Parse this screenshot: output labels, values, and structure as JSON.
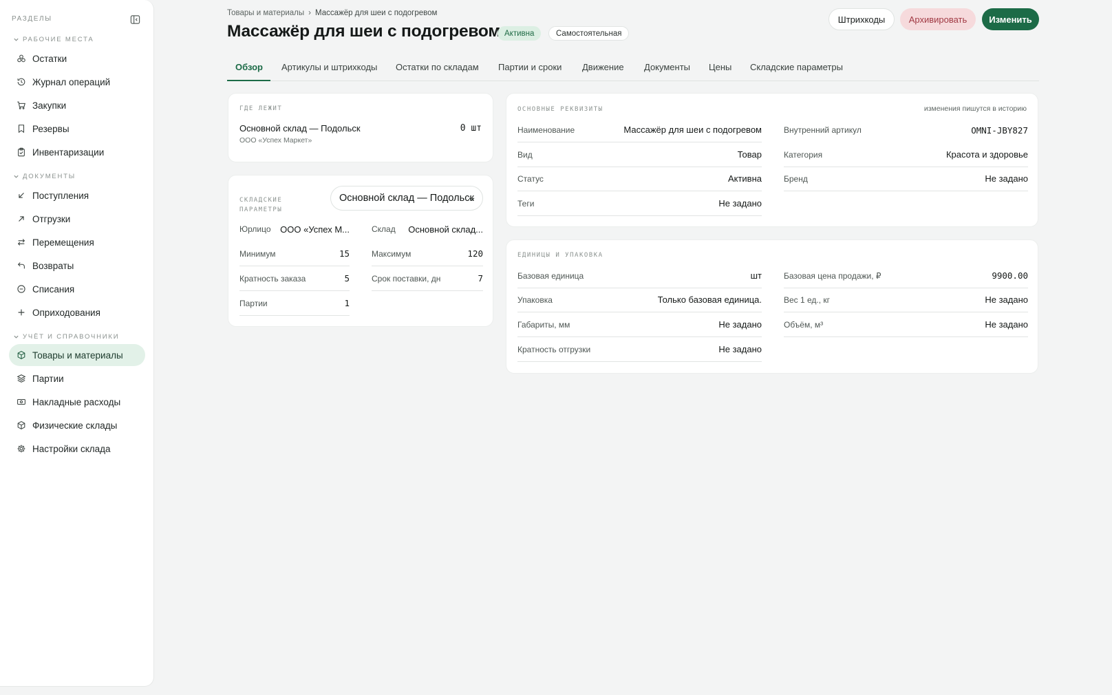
{
  "sidebar": {
    "header": "РАЗДЕЛЫ",
    "groups": [
      {
        "label": "РАБОЧИЕ МЕСТА",
        "items": [
          {
            "label": "Остатки",
            "icon": "boxes-icon"
          },
          {
            "label": "Журнал операций",
            "icon": "history-icon"
          },
          {
            "label": "Закупки",
            "icon": "cart-icon"
          },
          {
            "label": "Резервы",
            "icon": "bookmark-icon"
          },
          {
            "label": "Инвентаризации",
            "icon": "clipboard-icon"
          }
        ]
      },
      {
        "label": "ДОКУМЕНТЫ",
        "items": [
          {
            "label": "Поступления",
            "icon": "arrow-down-left-icon"
          },
          {
            "label": "Отгрузки",
            "icon": "arrow-up-right-icon"
          },
          {
            "label": "Перемещения",
            "icon": "swap-icon"
          },
          {
            "label": "Возвраты",
            "icon": "undo-icon"
          },
          {
            "label": "Списания",
            "icon": "minus-circle-icon"
          },
          {
            "label": "Оприходования",
            "icon": "plus-icon"
          }
        ]
      },
      {
        "label": "УЧЁТ И СПРАВОЧНИКИ",
        "items": [
          {
            "label": "Товары и материалы",
            "icon": "package-icon",
            "active": true
          },
          {
            "label": "Партии",
            "icon": "layers-icon"
          },
          {
            "label": "Накладные расходы",
            "icon": "banknote-icon"
          },
          {
            "label": "Физические склады",
            "icon": "package-icon"
          },
          {
            "label": "Настройки склада",
            "icon": "gear-icon"
          }
        ]
      }
    ]
  },
  "breadcrumb": {
    "parent": "Товары и материалы",
    "separator": "›",
    "current": "Массажёр для шеи с подогревом"
  },
  "header": {
    "title": "Массажёр для шеи с подогревом",
    "status_badge": "Активна",
    "type_badge": "Самостоятельная",
    "buttons": {
      "barcodes": "Штрихкоды",
      "archive": "Архивировать",
      "edit": "Изменить"
    }
  },
  "tabs": [
    "Обзор",
    "Артикулы и штрихкоды",
    "Остатки по складам",
    "Партии и сроки",
    "Движение",
    "Документы",
    "Цены",
    "Складские параметры"
  ],
  "where": {
    "caption": "ГДЕ ЛЕЖИТ",
    "warehouse": "Основной склад — Подольск",
    "company": "ООО «Успех Маркет»",
    "qty": "0 шт"
  },
  "stock_params": {
    "caption_line1": "СКЛАДСКИЕ",
    "caption_line2": "ПАРАМЕТРЫ",
    "select_value": "Основной склад — Подольск",
    "rows": [
      {
        "k": "Юрлицо",
        "v": "ООО «Успех М..."
      },
      {
        "k": "Склад",
        "v": "Основной склад..."
      },
      {
        "k": "Минимум",
        "v": "15"
      },
      {
        "k": "Максимум",
        "v": "120"
      },
      {
        "k": "Кратность заказа",
        "v": "5"
      },
      {
        "k": "Срок поставки, дн",
        "v": "7"
      },
      {
        "k": "Партии",
        "v": "1"
      }
    ]
  },
  "main_props": {
    "caption": "ОСНОВНЫЕ РЕКВИЗИТЫ",
    "note": "изменения пишутся в историю",
    "left": [
      {
        "k": "Наименование",
        "v": "Массажёр для шеи с подогревом"
      },
      {
        "k": "Вид",
        "v": "Товар"
      },
      {
        "k": "Статус",
        "v": "Активна"
      },
      {
        "k": "Теги",
        "v": "Не задано"
      }
    ],
    "right": [
      {
        "k": "Внутренний артикул",
        "v": "OMNI-JBY827"
      },
      {
        "k": "Категория",
        "v": "Красота и здоровье"
      },
      {
        "k": "Бренд",
        "v": "Не задано"
      }
    ]
  },
  "units": {
    "caption": "ЕДИНИЦЫ И УПАКОВКА",
    "left": [
      {
        "k": "Базовая единица",
        "v": "шт"
      },
      {
        "k": "Упаковка",
        "v": "Только базовая единица."
      },
      {
        "k": "Габариты, мм",
        "v": "Не задано"
      },
      {
        "k": "Кратность отгрузки",
        "v": "Не задано"
      }
    ],
    "right": [
      {
        "k": "Базовая цена продажи, ₽",
        "v": "9900.00"
      },
      {
        "k": "Вес 1 ед., кг",
        "v": "Не задано"
      },
      {
        "k": "Объём, м³",
        "v": "Не задано"
      }
    ]
  }
}
